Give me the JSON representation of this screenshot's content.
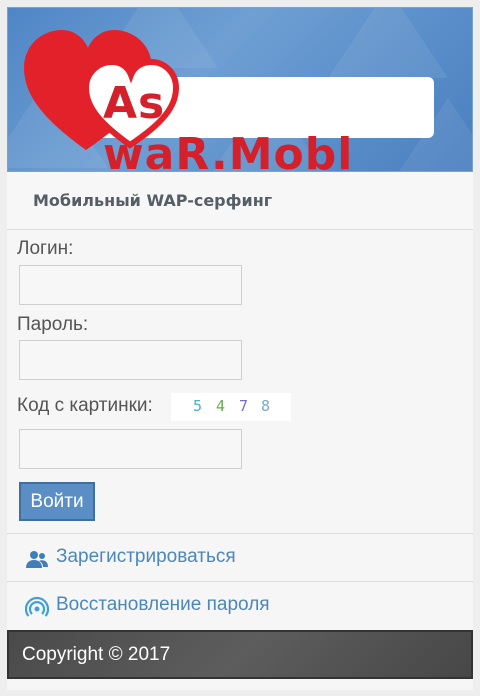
{
  "header": {
    "logo_left": "As",
    "logo_right": "waR.Mobl"
  },
  "subtitle": "Мобильный WAP-серфинг",
  "form": {
    "login_label": "Логин:",
    "login_value": "",
    "password_label": "Пароль:",
    "password_value": "",
    "captcha_label": "Код с картинки:",
    "captcha_digits": [
      "5",
      "4",
      "7",
      "8"
    ],
    "captcha_colors": [
      "#49b3c3",
      "#6aa84f",
      "#7a6cc9",
      "#7aa9c9"
    ],
    "captcha_value": "",
    "submit_label": "Войти"
  },
  "links": {
    "register": {
      "label": "Зарегистрироваться",
      "icon": "users-icon"
    },
    "recover": {
      "label": "Восстановление пароля",
      "icon": "signal-icon"
    }
  },
  "footer": {
    "copyright": "Copyright © 2017"
  },
  "colors": {
    "brand_red": "#d4202a",
    "header_blue": "#5b8fca",
    "link_blue": "#4b87b9",
    "button_blue": "#5a8ec4"
  }
}
